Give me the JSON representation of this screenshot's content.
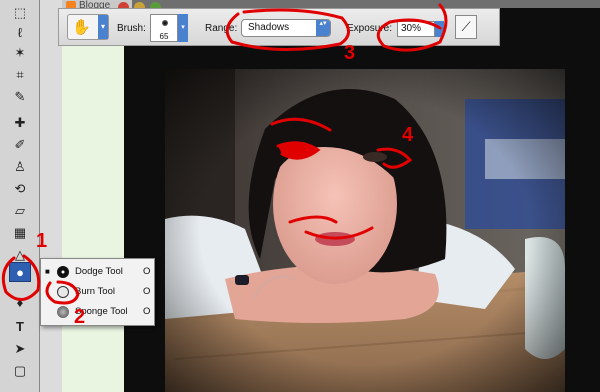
{
  "browser": {
    "tab_label": "Blogge"
  },
  "options_bar": {
    "brush_label": "Brush:",
    "brush_size": "65",
    "range_label": "Range:",
    "range_value": "Shadows",
    "exposure_label": "Exposure:",
    "exposure_value": "30%",
    "arrow_glyph": "▾",
    "updown_glyph": "▴▾"
  },
  "toolbox": {
    "tools": [
      "marquee",
      "move",
      "lasso",
      "magic-wand",
      "crop",
      "slice",
      "healing",
      "brush",
      "stamp",
      "history-brush",
      "eraser",
      "gradient",
      "blur",
      "dodge",
      "pen",
      "type",
      "path-select",
      "shape"
    ],
    "type_tool_glyph": "T"
  },
  "flyout": {
    "items": [
      {
        "label": "Dodge Tool",
        "shortcut": "O",
        "selected": true
      },
      {
        "label": "Burn Tool",
        "shortcut": "O",
        "selected": false
      },
      {
        "label": "Sponge Tool",
        "shortcut": "O",
        "selected": false
      }
    ]
  },
  "annotations": [
    "1",
    "2",
    "3",
    "4"
  ],
  "colors": {
    "annotation": "#e00000",
    "accent": "#4a82d0",
    "active_tool": "#2f5fb0"
  }
}
